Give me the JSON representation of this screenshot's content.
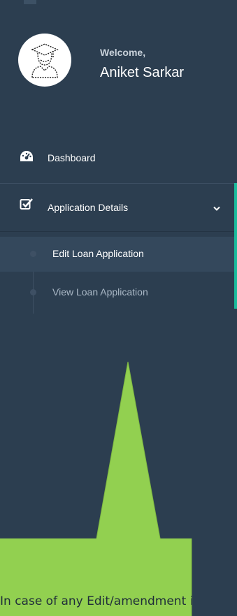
{
  "profile": {
    "welcome": "Welcome,",
    "name": "Aniket Sarkar",
    "avatar_icon": "graduate-user-icon"
  },
  "nav": {
    "dashboard": {
      "label": "Dashboard",
      "icon": "dashboard-gauge-icon"
    },
    "application_details": {
      "label": "Application Details",
      "icon": "checkbox-edit-icon",
      "expanded": true
    },
    "submenu": [
      {
        "label": "Edit Loan Application",
        "active": true
      },
      {
        "label": "View Loan Application",
        "active": false
      }
    ]
  },
  "callout": {
    "text": "In case of any Edit/amendment in",
    "color": "#92d050"
  },
  "colors": {
    "sidebar_bg": "#2c3e50",
    "active_accent": "#1abc9c"
  }
}
